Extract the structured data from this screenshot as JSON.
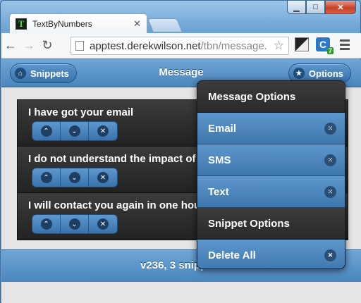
{
  "browser": {
    "tab_title": "TextByNumbers",
    "favicon_letter": "T",
    "url_host": "apptest.derekwilson.net",
    "url_path": "/tbn/message.",
    "extension_badge": "7",
    "extension_letter": "C"
  },
  "header": {
    "title": "Message",
    "snippets_label": "Snippets",
    "options_label": "Options"
  },
  "messages": [
    {
      "text": "I have got your email"
    },
    {
      "text": "I do not understand the impact of"
    },
    {
      "text": "I will contact you again in one hour"
    }
  ],
  "footer": {
    "status": "v236, 3 snippets"
  },
  "popup": {
    "message_options_heading": "Message Options",
    "email_label": "Email",
    "sms_label": "SMS",
    "text_label": "Text",
    "snippet_options_heading": "Snippet Options",
    "delete_all_label": "Delete All"
  },
  "colors": {
    "accent": "#4a85bd",
    "dark_row": "#222222"
  },
  "icons": {
    "up": "chevron-up-icon",
    "down": "chevron-down-icon",
    "remove": "close-icon",
    "grid": "grid-icon",
    "home": "home-icon",
    "star": "star-icon"
  }
}
